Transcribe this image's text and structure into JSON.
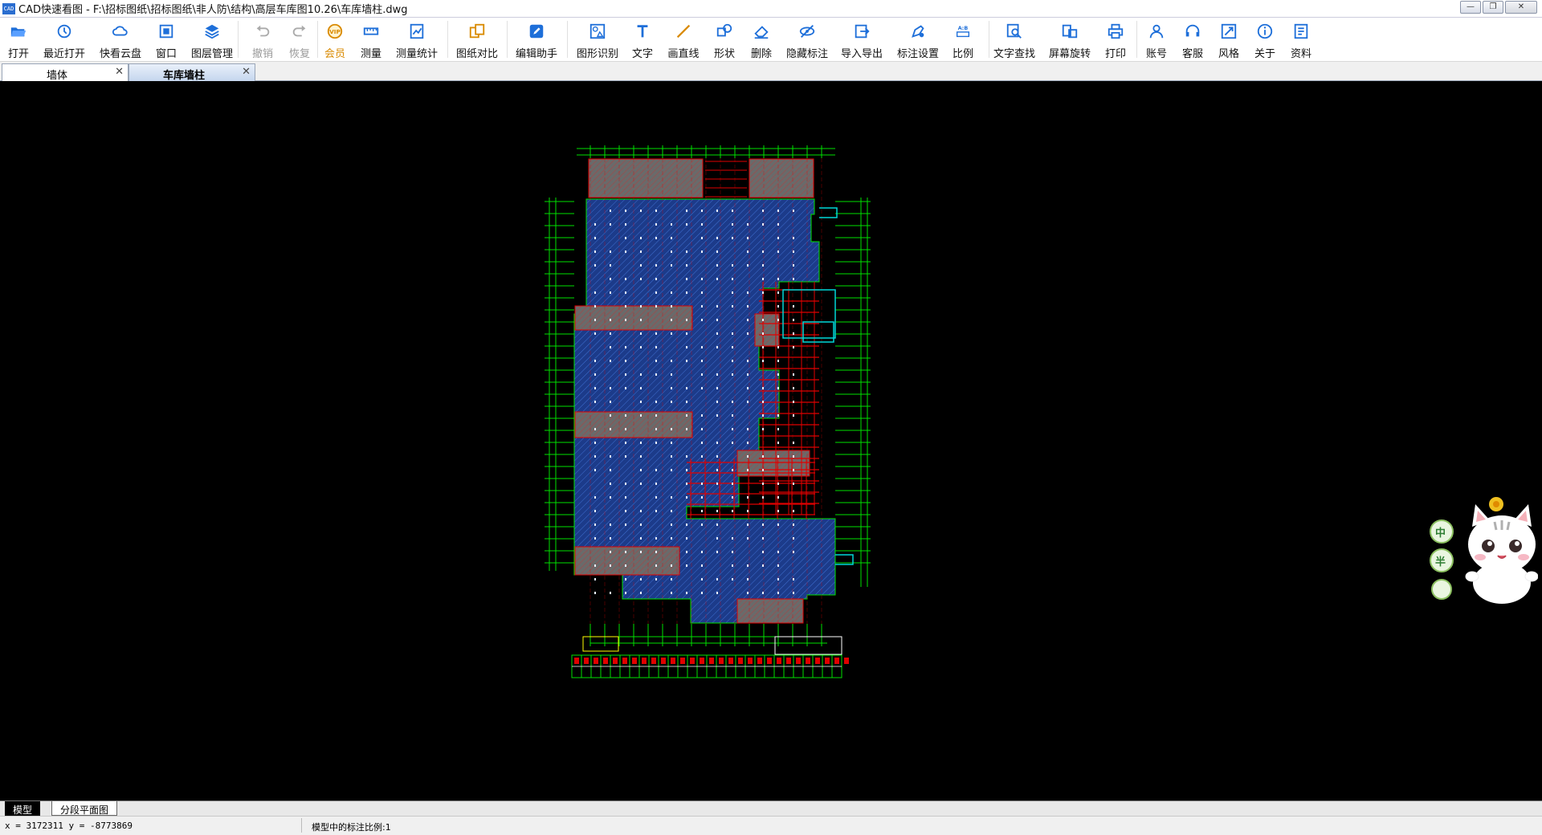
{
  "window": {
    "app_icon": "CAD",
    "title": "CAD快速看图 - F:\\招标图纸\\招标图纸\\非人防\\结构\\高层车库图10.26\\车库墙柱.dwg",
    "minimize": "—",
    "restore": "❐",
    "close": "✕"
  },
  "toolbar": {
    "items": [
      {
        "label": "打开",
        "icon": "folder-open-icon"
      },
      {
        "label": "最近打开",
        "icon": "history-icon"
      },
      {
        "label": "快看云盘",
        "icon": "cloud-icon"
      },
      {
        "label": "窗口",
        "icon": "window-fit-icon"
      },
      {
        "label": "图层管理",
        "icon": "layers-icon"
      },
      {
        "label": "撤销",
        "icon": "undo-icon",
        "disabled": true
      },
      {
        "label": "恢复",
        "icon": "redo-icon",
        "disabled": true
      },
      {
        "label": "会员",
        "icon": "vip-icon",
        "vip": true
      },
      {
        "label": "测量",
        "icon": "ruler-icon"
      },
      {
        "label": "测量统计",
        "icon": "measure-stats-icon"
      },
      {
        "label": "图纸对比",
        "icon": "compare-icon"
      },
      {
        "label": "编辑助手",
        "icon": "edit-assistant-icon"
      },
      {
        "label": "图形识别",
        "icon": "shape-recognize-icon"
      },
      {
        "label": "文字",
        "icon": "text-icon"
      },
      {
        "label": "画直线",
        "icon": "line-icon"
      },
      {
        "label": "形状",
        "icon": "shape-icon"
      },
      {
        "label": "删除",
        "icon": "eraser-icon"
      },
      {
        "label": "隐藏标注",
        "icon": "hide-annotation-icon"
      },
      {
        "label": "导入导出",
        "icon": "import-export-icon"
      },
      {
        "label": "标注设置",
        "icon": "annotation-settings-icon"
      },
      {
        "label": "比例",
        "icon": "scale-icon"
      },
      {
        "label": "文字查找",
        "icon": "text-search-icon"
      },
      {
        "label": "屏幕旋转",
        "icon": "rotate-screen-icon"
      },
      {
        "label": "打印",
        "icon": "print-icon"
      },
      {
        "label": "账号",
        "icon": "account-icon"
      },
      {
        "label": "客服",
        "icon": "headset-icon"
      },
      {
        "label": "风格",
        "icon": "style-icon"
      },
      {
        "label": "关于",
        "icon": "info-icon"
      },
      {
        "label": "资料",
        "icon": "docs-icon"
      }
    ]
  },
  "tabs": [
    {
      "label": "墙体",
      "close": "✕",
      "active": false
    },
    {
      "label": "车库墙柱",
      "close": "✕",
      "active": true
    }
  ],
  "mascot": {
    "badges": [
      "中",
      "半"
    ]
  },
  "layout_tabs": {
    "model": "模型",
    "segment": "分段平面图"
  },
  "status": {
    "coords": "x = 3172311  y = -8773869",
    "scale": "模型中的标注比例:1"
  },
  "colors": {
    "accent": "#1e6fd9",
    "vip": "#d98a00",
    "cad_green": "#00e000",
    "cad_red": "#e00000",
    "cad_blue_fill": "#1c3b8a",
    "cad_cyan": "#00d8d8"
  }
}
